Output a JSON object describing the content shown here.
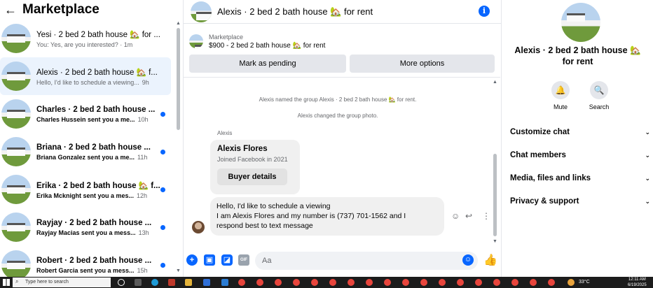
{
  "left": {
    "title": "Marketplace",
    "conversations": [
      {
        "title": "Yesi · 2 bed 2 bath house 🏡 for ...",
        "snippet": "You: Yes, are you interested? · 1m",
        "time": "",
        "unread": false
      },
      {
        "title": "Alexis · 2 bed 2 bath house 🏡 f...",
        "snippet": "Hello, I'd like to schedule a viewing...",
        "time": "9h",
        "unread": false
      },
      {
        "title": "Charles · 2 bed 2 bath house ...",
        "snippet": "Charles Hussein sent you a me...",
        "time": "10h",
        "unread": true
      },
      {
        "title": "Briana · 2 bed 2 bath house ...",
        "snippet": "Briana Gonzalez sent you a me...",
        "time": "11h",
        "unread": true
      },
      {
        "title": "Erika · 2 bed 2 bath house 🏡 f...",
        "snippet": "Erika Mcknight sent you a mes...",
        "time": "12h",
        "unread": true
      },
      {
        "title": "Rayjay · 2 bed 2 bath house ...",
        "snippet": "Rayjay Macias sent you a mess...",
        "time": "13h",
        "unread": true
      },
      {
        "title": "Robert · 2 bed 2 bath house ...",
        "snippet": "Robert Garcia sent you a mess...",
        "time": "15h",
        "unread": true
      }
    ]
  },
  "chat": {
    "title": "Alexis · 2 bed 2 bath house 🏡 for rent",
    "marketplace_label": "Marketplace",
    "listing": "$900 - 2 bed 2 bath house 🏡 for rent",
    "mark_pending": "Mark as pending",
    "more_options": "More options",
    "system_1": "Alexis named the group Alexis · 2 bed 2 bath house 🏡 for rent.",
    "system_2": "Alexis changed the group photo.",
    "sender": "Alexis",
    "card_name": "Alexis Flores",
    "card_sub": "Joined Facebook in 2021",
    "card_button": "Buyer details",
    "message_lines": [
      "Hello, I'd like to schedule a viewing",
      "I am Alexis Flores and my number is (737) 701-1562 and I",
      "respond best to text message"
    ],
    "composer_placeholder": "Aa"
  },
  "right": {
    "title": "Alexis · 2 bed 2 bath house 🏡 for rent",
    "mute": "Mute",
    "search": "Search",
    "sections": [
      "Customize chat",
      "Chat members",
      "Media, files and links",
      "Privacy & support"
    ]
  },
  "taskbar": {
    "search_placeholder": "Type here to search",
    "temperature": "33°C",
    "time": "12:11 AM",
    "date": "6/19/2025"
  },
  "colors": {
    "accent": "#0866ff",
    "unread_dot": "#0866ff",
    "selected_bg": "#ebf3fd"
  }
}
